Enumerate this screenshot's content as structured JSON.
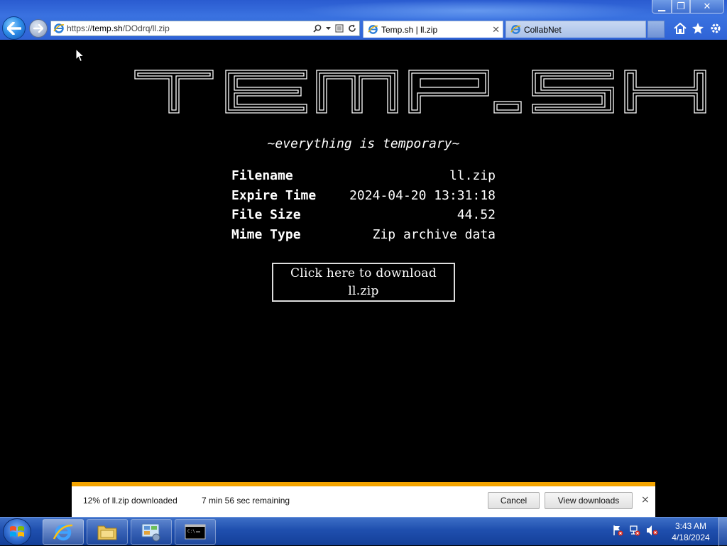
{
  "browser": {
    "address": {
      "prefix": "https://",
      "host": "temp.sh",
      "path": "/DOdrq/ll.zip"
    },
    "tabs": [
      {
        "label": "Temp.sh | ll.zip",
        "active": true
      },
      {
        "label": "CollabNet",
        "active": false
      }
    ],
    "window_buttons": {
      "minimize": "▁",
      "maximize": "❐",
      "close": "✕"
    },
    "tab_close": "✕"
  },
  "page": {
    "logo": "TEMP.SH",
    "tagline": "~everything is temporary~",
    "info": [
      {
        "key": "Filename",
        "value": "ll.zip"
      },
      {
        "key": "Expire Time",
        "value": "2024-04-20 13:31:18"
      },
      {
        "key": "File Size",
        "value": "44.52"
      },
      {
        "key": "Mime Type",
        "value": "Zip archive data"
      }
    ],
    "download_button": {
      "line1": "Click here to download",
      "line2": "ll.zip"
    }
  },
  "download_bar": {
    "progress_percent": 12,
    "status": "12% of ll.zip downloaded",
    "remaining": "7 min 56 sec remaining",
    "cancel_label": "Cancel",
    "view_label": "View downloads",
    "close_label": "×",
    "progress_color": "#f4a400"
  },
  "taskbar": {
    "items": [
      "internet-explorer",
      "windows-explorer",
      "control-panel",
      "command-prompt"
    ],
    "clock": {
      "time": "3:43 AM",
      "date": "4/18/2024"
    }
  }
}
